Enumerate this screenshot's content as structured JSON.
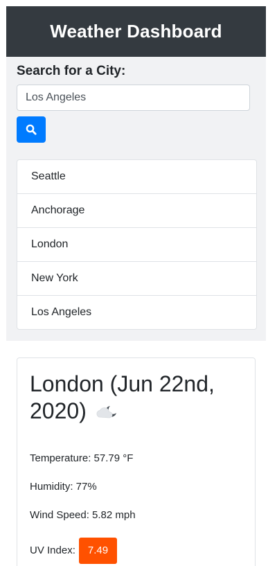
{
  "header": {
    "title": "Weather Dashboard"
  },
  "search": {
    "label": "Search for a City:",
    "value": "Los Angeles",
    "button_icon": "search-icon"
  },
  "history": {
    "items": [
      {
        "label": "Seattle"
      },
      {
        "label": "Anchorage"
      },
      {
        "label": "London"
      },
      {
        "label": "New York"
      },
      {
        "label": "Los Angeles"
      }
    ]
  },
  "current": {
    "title": "London (Jun 22nd, 2020)",
    "icon": "partly-cloudy-night-icon",
    "temperature": "Temperature: 57.79 °F",
    "humidity": "Humidity: 77%",
    "wind": "Wind Speed: 5.82 mph",
    "uv_label": "UV Index:",
    "uv_value": "7.49"
  },
  "colors": {
    "header_bg": "#343a40",
    "accent": "#007bff",
    "uv_severe": "#ff5100"
  }
}
